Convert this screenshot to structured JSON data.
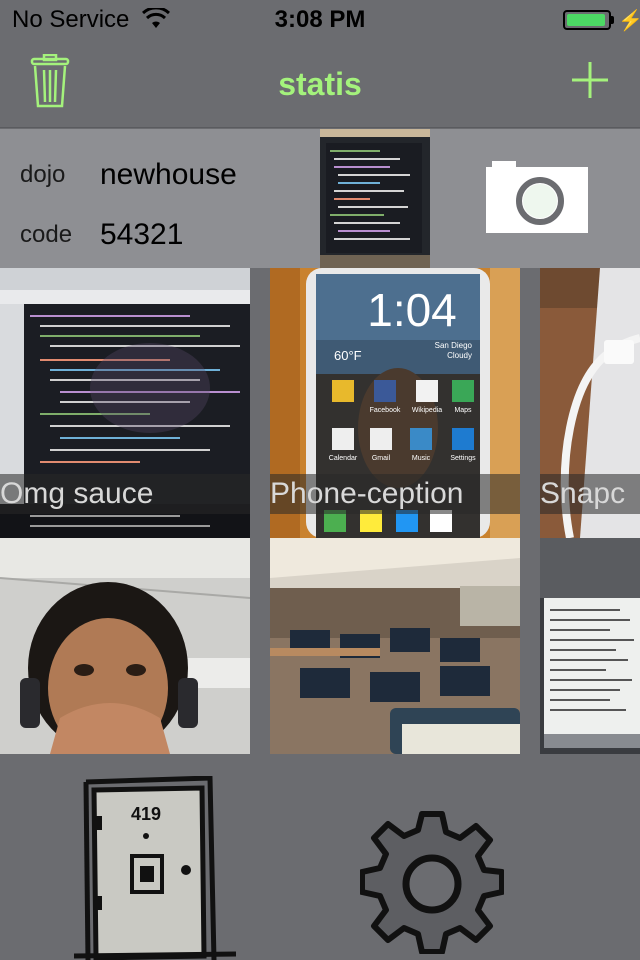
{
  "status_bar": {
    "carrier": "No Service",
    "time": "3:08 PM",
    "battery_level": 0.95,
    "icons": [
      "wifi-icon",
      "battery-icon",
      "charging-bolt-icon"
    ]
  },
  "nav": {
    "title": "statis",
    "title_color": "#a4f27c",
    "left_icon": "trash-icon",
    "right_icon": "plus-icon"
  },
  "info": {
    "dojo_label": "dojo",
    "dojo_value": "newhouse",
    "code_label": "code",
    "code_value": "54321",
    "camera_icon": "camera-icon"
  },
  "photos": [
    {
      "caption": "Omg sauce"
    },
    {
      "caption": "Phone-ception"
    },
    {
      "caption": "Snapc"
    },
    {
      "caption": ""
    },
    {
      "caption": ""
    },
    {
      "caption": ""
    }
  ],
  "phone_screen": {
    "time": "1:04",
    "temp": "60°F",
    "city": "San Diego",
    "weather": "Cloudy",
    "apps_row1": [
      "Facebook",
      "Wikipedia",
      "Maps"
    ],
    "apps_row2": [
      "Calendar",
      "Gmail",
      "Music",
      "Settings"
    ]
  },
  "door_sign": "419",
  "toolbar_icons": [
    "door-icon",
    "gear-icon"
  ]
}
